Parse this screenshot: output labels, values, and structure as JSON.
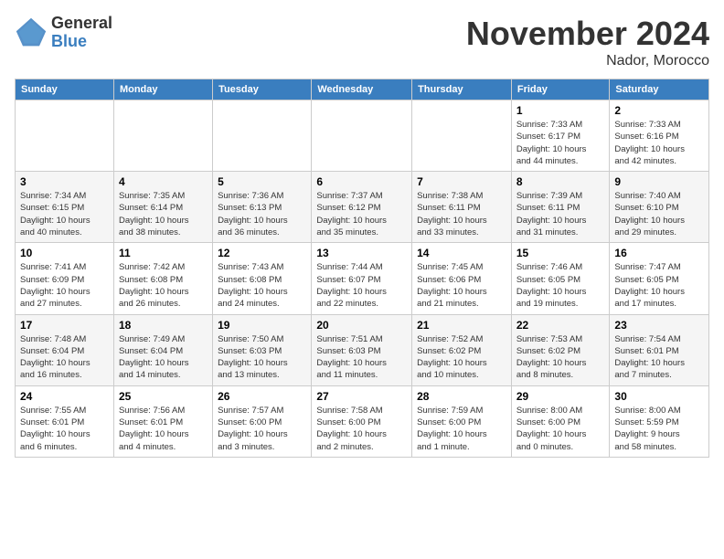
{
  "logo": {
    "general": "General",
    "blue": "Blue"
  },
  "title": "November 2024",
  "location": "Nador, Morocco",
  "headers": [
    "Sunday",
    "Monday",
    "Tuesday",
    "Wednesday",
    "Thursday",
    "Friday",
    "Saturday"
  ],
  "weeks": [
    [
      {
        "day": "",
        "info": ""
      },
      {
        "day": "",
        "info": ""
      },
      {
        "day": "",
        "info": ""
      },
      {
        "day": "",
        "info": ""
      },
      {
        "day": "",
        "info": ""
      },
      {
        "day": "1",
        "info": "Sunrise: 7:33 AM\nSunset: 6:17 PM\nDaylight: 10 hours\nand 44 minutes."
      },
      {
        "day": "2",
        "info": "Sunrise: 7:33 AM\nSunset: 6:16 PM\nDaylight: 10 hours\nand 42 minutes."
      }
    ],
    [
      {
        "day": "3",
        "info": "Sunrise: 7:34 AM\nSunset: 6:15 PM\nDaylight: 10 hours\nand 40 minutes."
      },
      {
        "day": "4",
        "info": "Sunrise: 7:35 AM\nSunset: 6:14 PM\nDaylight: 10 hours\nand 38 minutes."
      },
      {
        "day": "5",
        "info": "Sunrise: 7:36 AM\nSunset: 6:13 PM\nDaylight: 10 hours\nand 36 minutes."
      },
      {
        "day": "6",
        "info": "Sunrise: 7:37 AM\nSunset: 6:12 PM\nDaylight: 10 hours\nand 35 minutes."
      },
      {
        "day": "7",
        "info": "Sunrise: 7:38 AM\nSunset: 6:11 PM\nDaylight: 10 hours\nand 33 minutes."
      },
      {
        "day": "8",
        "info": "Sunrise: 7:39 AM\nSunset: 6:11 PM\nDaylight: 10 hours\nand 31 minutes."
      },
      {
        "day": "9",
        "info": "Sunrise: 7:40 AM\nSunset: 6:10 PM\nDaylight: 10 hours\nand 29 minutes."
      }
    ],
    [
      {
        "day": "10",
        "info": "Sunrise: 7:41 AM\nSunset: 6:09 PM\nDaylight: 10 hours\nand 27 minutes."
      },
      {
        "day": "11",
        "info": "Sunrise: 7:42 AM\nSunset: 6:08 PM\nDaylight: 10 hours\nand 26 minutes."
      },
      {
        "day": "12",
        "info": "Sunrise: 7:43 AM\nSunset: 6:08 PM\nDaylight: 10 hours\nand 24 minutes."
      },
      {
        "day": "13",
        "info": "Sunrise: 7:44 AM\nSunset: 6:07 PM\nDaylight: 10 hours\nand 22 minutes."
      },
      {
        "day": "14",
        "info": "Sunrise: 7:45 AM\nSunset: 6:06 PM\nDaylight: 10 hours\nand 21 minutes."
      },
      {
        "day": "15",
        "info": "Sunrise: 7:46 AM\nSunset: 6:05 PM\nDaylight: 10 hours\nand 19 minutes."
      },
      {
        "day": "16",
        "info": "Sunrise: 7:47 AM\nSunset: 6:05 PM\nDaylight: 10 hours\nand 17 minutes."
      }
    ],
    [
      {
        "day": "17",
        "info": "Sunrise: 7:48 AM\nSunset: 6:04 PM\nDaylight: 10 hours\nand 16 minutes."
      },
      {
        "day": "18",
        "info": "Sunrise: 7:49 AM\nSunset: 6:04 PM\nDaylight: 10 hours\nand 14 minutes."
      },
      {
        "day": "19",
        "info": "Sunrise: 7:50 AM\nSunset: 6:03 PM\nDaylight: 10 hours\nand 13 minutes."
      },
      {
        "day": "20",
        "info": "Sunrise: 7:51 AM\nSunset: 6:03 PM\nDaylight: 10 hours\nand 11 minutes."
      },
      {
        "day": "21",
        "info": "Sunrise: 7:52 AM\nSunset: 6:02 PM\nDaylight: 10 hours\nand 10 minutes."
      },
      {
        "day": "22",
        "info": "Sunrise: 7:53 AM\nSunset: 6:02 PM\nDaylight: 10 hours\nand 8 minutes."
      },
      {
        "day": "23",
        "info": "Sunrise: 7:54 AM\nSunset: 6:01 PM\nDaylight: 10 hours\nand 7 minutes."
      }
    ],
    [
      {
        "day": "24",
        "info": "Sunrise: 7:55 AM\nSunset: 6:01 PM\nDaylight: 10 hours\nand 6 minutes."
      },
      {
        "day": "25",
        "info": "Sunrise: 7:56 AM\nSunset: 6:01 PM\nDaylight: 10 hours\nand 4 minutes."
      },
      {
        "day": "26",
        "info": "Sunrise: 7:57 AM\nSunset: 6:00 PM\nDaylight: 10 hours\nand 3 minutes."
      },
      {
        "day": "27",
        "info": "Sunrise: 7:58 AM\nSunset: 6:00 PM\nDaylight: 10 hours\nand 2 minutes."
      },
      {
        "day": "28",
        "info": "Sunrise: 7:59 AM\nSunset: 6:00 PM\nDaylight: 10 hours\nand 1 minute."
      },
      {
        "day": "29",
        "info": "Sunrise: 8:00 AM\nSunset: 6:00 PM\nDaylight: 10 hours\nand 0 minutes."
      },
      {
        "day": "30",
        "info": "Sunrise: 8:00 AM\nSunset: 5:59 PM\nDaylight: 9 hours\nand 58 minutes."
      }
    ]
  ]
}
